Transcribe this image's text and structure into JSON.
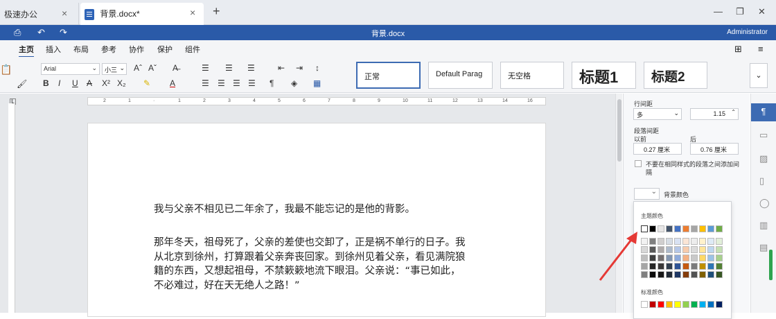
{
  "tabs": {
    "app_tab": "极速办公",
    "doc_tab": "背景.docx*"
  },
  "title": {
    "doc_name": "背景.docx",
    "user": "Administrator"
  },
  "menu": [
    "主页",
    "插入",
    "布局",
    "参考",
    "协作",
    "保护",
    "组件"
  ],
  "ribbon": {
    "font": "Arial",
    "size": "小三"
  },
  "styles": [
    "正常",
    "Default Parag",
    "无空格",
    "标题1",
    "标题2"
  ],
  "document": {
    "p1": "我与父亲不相见已二年余了，我最不能忘记的是他的背影。",
    "p2_lines": [
      "那年冬天，祖母死了，父亲的差使也交卸了，正是祸不单行的日子。我",
      "从北京到徐州，打算跟着父亲奔丧回家。到徐州见着父亲，看见满院狼",
      "籍的东西，又想起祖母，不禁簌簌地流下眼泪。父亲说：“事已如此，",
      "不必难过，好在天无绝人之路！”"
    ]
  },
  "panel": {
    "line_spacing_label": "行间距",
    "line_spacing_mode": "多",
    "line_spacing_value": "1.15",
    "para_spacing_label": "段落间距",
    "before_label": "以前",
    "after_label": "后",
    "before_value": "0.27 厘米",
    "after_value": "0.76 厘米",
    "no_space_label_1": "不要在相同样式的段落之间添加间",
    "no_space_label_2": "隔",
    "bg_color_label": "背景颜色"
  },
  "color_picker": {
    "theme_label": "主题颜色",
    "standard_label": "标准颜色",
    "theme_row": [
      "#ffffff",
      "#000000",
      "#e7e6e6",
      "#44546a",
      "#4472c4",
      "#ed7d31",
      "#a5a5a5",
      "#ffc000",
      "#5b9bd5",
      "#70ad47"
    ],
    "shade_rows": [
      [
        "#f2f2f2",
        "#7f7f7f",
        "#d0cece",
        "#d6dce4",
        "#d9e2f3",
        "#fbe5d5",
        "#ededed",
        "#fff2cc",
        "#deebf6",
        "#e2efd9"
      ],
      [
        "#d8d8d8",
        "#595959",
        "#aeaaaa",
        "#adb9ca",
        "#b4c6e7",
        "#f7cbac",
        "#dbdbdb",
        "#ffe599",
        "#bdd7ee",
        "#c5e0b3"
      ],
      [
        "#bfbfbf",
        "#3f3f3f",
        "#757070",
        "#8496b0",
        "#8eaadb",
        "#f4b083",
        "#c9c9c9",
        "#ffd965",
        "#9cc3e5",
        "#a8d08d"
      ],
      [
        "#a5a5a5",
        "#262626",
        "#3a3838",
        "#323f4f",
        "#2f5496",
        "#c55a11",
        "#7b7b7b",
        "#bf8f00",
        "#2e75b5",
        "#538135"
      ],
      [
        "#7f7f7f",
        "#0c0c0c",
        "#171616",
        "#222a35",
        "#1f3864",
        "#843c0b",
        "#525252",
        "#7f6000",
        "#1e4e79",
        "#375623"
      ]
    ],
    "standard_row": [
      "#ffffff",
      "#c00000",
      "#ff0000",
      "#ffc000",
      "#ffff00",
      "#92d050",
      "#00b050",
      "#00b0f0",
      "#0070c0",
      "#002060"
    ]
  }
}
